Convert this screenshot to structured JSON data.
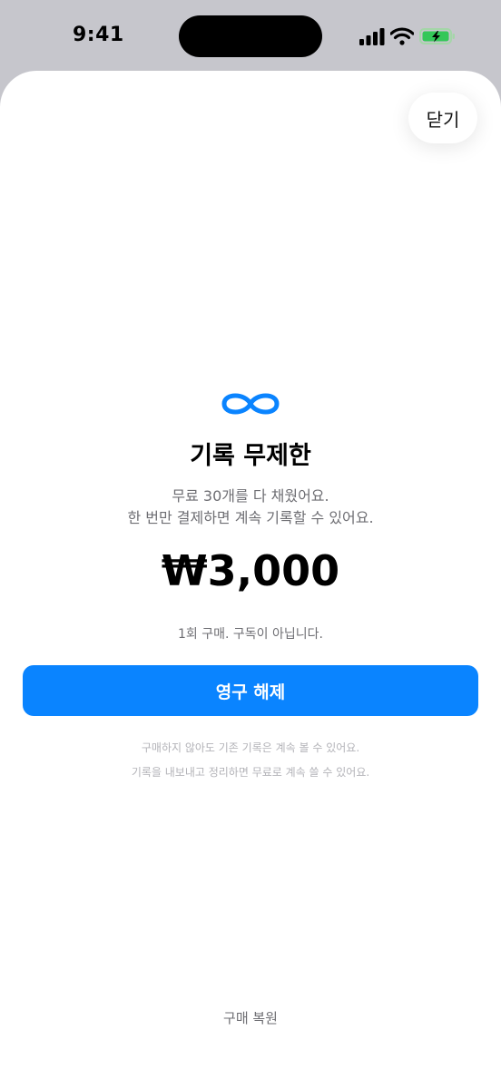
{
  "status_bar": {
    "time": "9:41"
  },
  "sheet": {
    "close_label": "닫기",
    "title": "기록 무제한",
    "subtitle_line1": "무료 30개를 다 채웠어요.",
    "subtitle_line2": "한 번만 결제하면 계속 기록할 수 있어요.",
    "price": "₩3,000",
    "purchase_note": "1회 구매. 구독이 아닙니다.",
    "unlock_button_label": "영구 해제",
    "footnote_line1": "구매하지 않아도 기존 기록은 계속 볼 수 있어요.",
    "footnote_line2": "기록을 내보내고 정리하면 무료로 계속 쓸 수 있어요.",
    "restore_label": "구매 복원"
  },
  "icons": {
    "hero": "infinity-icon",
    "signal": "cellular-signal-icon",
    "wifi": "wifi-icon",
    "battery": "battery-charging-icon"
  },
  "colors": {
    "accent": "#0a84ff",
    "battery": "#34c759",
    "secondary_text": "#6e6e73",
    "tertiary_text": "#b3b3b8"
  }
}
